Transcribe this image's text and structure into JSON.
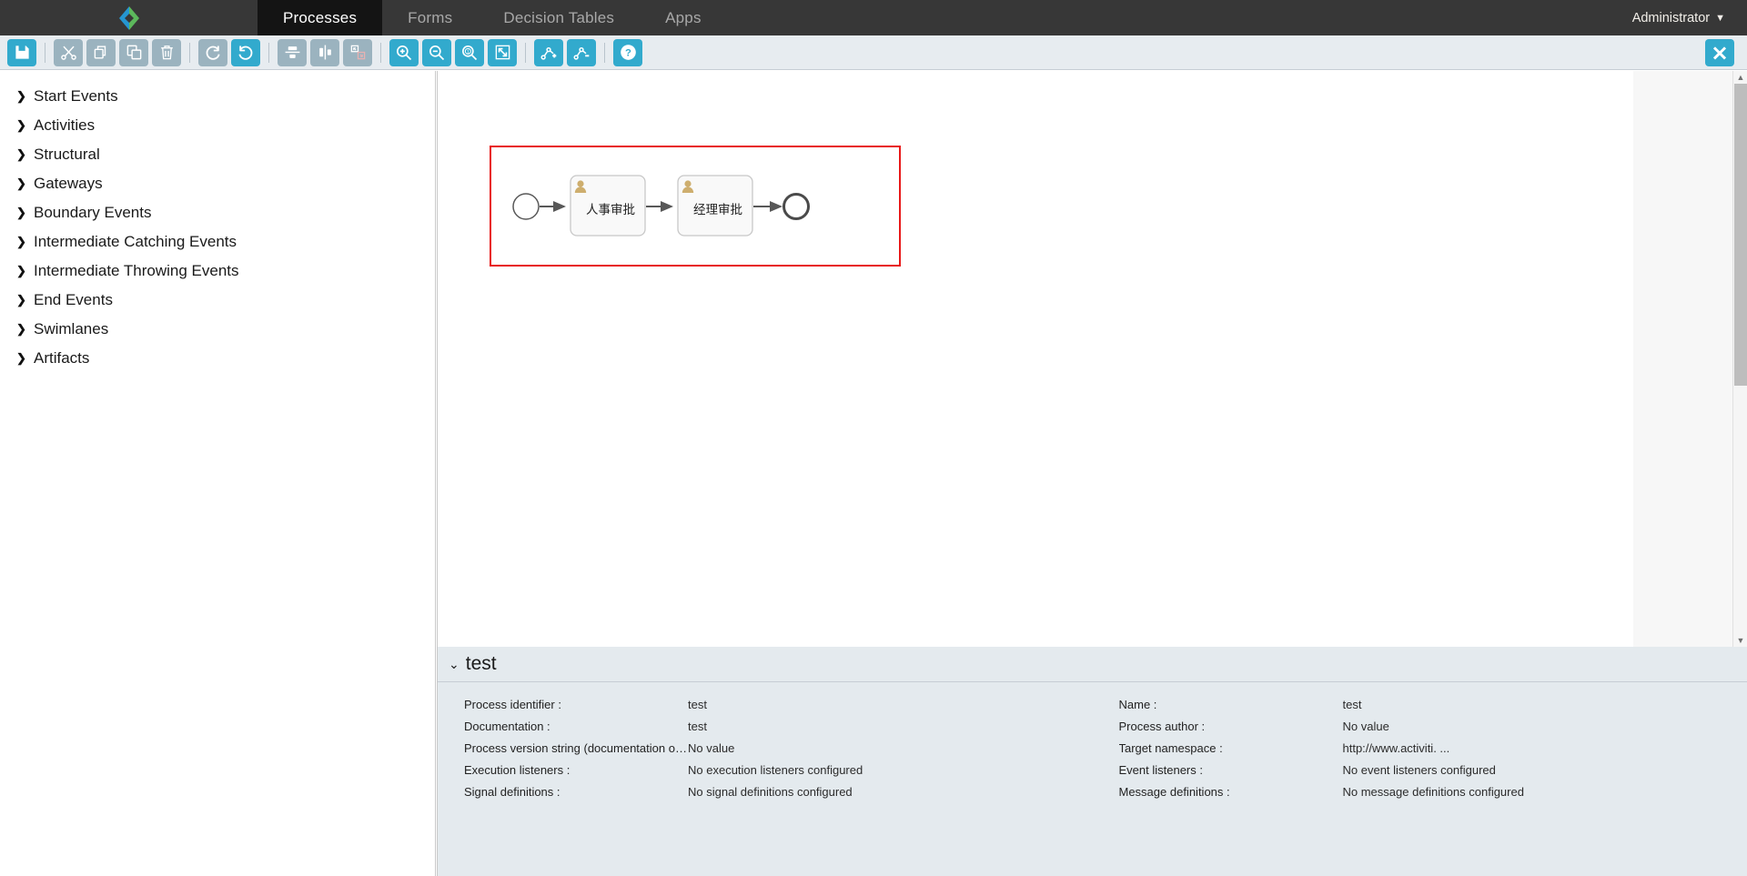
{
  "topnav": {
    "logo_icon": "activiti-diamond-logo",
    "tabs": [
      {
        "label": "Processes",
        "active": true
      },
      {
        "label": "Forms",
        "active": false
      },
      {
        "label": "Decision Tables",
        "active": false
      },
      {
        "label": "Apps",
        "active": false
      }
    ],
    "user": "Administrator",
    "user_caret": "⌄"
  },
  "toolbar": {
    "buttons": [
      {
        "name": "save-button",
        "icon": "floppy-disk-icon",
        "style": "cyan"
      },
      {
        "name": "separator",
        "icon": "separator",
        "style": "sep"
      },
      {
        "name": "cut-button",
        "icon": "scissors-icon",
        "style": "grey"
      },
      {
        "name": "copy-button",
        "icon": "copy-icon",
        "style": "grey"
      },
      {
        "name": "paste-button",
        "icon": "paste-icon",
        "style": "grey"
      },
      {
        "name": "delete-button",
        "icon": "trash-icon",
        "style": "grey"
      },
      {
        "name": "separator",
        "icon": "separator",
        "style": "sep"
      },
      {
        "name": "redo-button",
        "icon": "redo-arrow-icon",
        "style": "grey"
      },
      {
        "name": "undo-button",
        "icon": "undo-arrow-icon",
        "style": "cyan"
      },
      {
        "name": "separator",
        "icon": "separator",
        "style": "sep"
      },
      {
        "name": "align-vertical-button",
        "icon": "align-vertical-icon",
        "style": "grey"
      },
      {
        "name": "align-horizontal-button",
        "icon": "align-horizontal-icon",
        "style": "grey"
      },
      {
        "name": "same-size-button",
        "icon": "same-size-icon",
        "style": "grey"
      },
      {
        "name": "separator",
        "icon": "separator",
        "style": "sep"
      },
      {
        "name": "zoom-in-button",
        "icon": "zoom-in-icon",
        "style": "cyan"
      },
      {
        "name": "zoom-out-button",
        "icon": "zoom-out-icon",
        "style": "cyan"
      },
      {
        "name": "zoom-actual-button",
        "icon": "zoom-actual-size-icon",
        "style": "cyan"
      },
      {
        "name": "zoom-fit-button",
        "icon": "zoom-fit-icon",
        "style": "cyan"
      },
      {
        "name": "separator",
        "icon": "separator",
        "style": "sep"
      },
      {
        "name": "add-bendpoint-button",
        "icon": "add-bendpoint-icon",
        "style": "cyan"
      },
      {
        "name": "remove-bendpoint-button",
        "icon": "remove-bendpoint-icon",
        "style": "cyan"
      },
      {
        "name": "separator",
        "icon": "separator",
        "style": "sep"
      },
      {
        "name": "help-button",
        "icon": "question-mark-icon",
        "style": "cyan"
      }
    ],
    "close_button": {
      "name": "close-editor-button",
      "icon": "close-x-icon",
      "style": "cyan"
    }
  },
  "palette": {
    "items": [
      {
        "label": "Start Events"
      },
      {
        "label": "Activities"
      },
      {
        "label": "Structural"
      },
      {
        "label": "Gateways"
      },
      {
        "label": "Boundary Events"
      },
      {
        "label": "Intermediate Catching Events"
      },
      {
        "label": "Intermediate Throwing Events"
      },
      {
        "label": "End Events"
      },
      {
        "label": "Swimlanes"
      },
      {
        "label": "Artifacts"
      }
    ],
    "expand_arrow": "❯"
  },
  "diagram": {
    "selection_color": "#e81919",
    "nodes": [
      {
        "type": "start-event",
        "name": "start-event",
        "label": ""
      },
      {
        "type": "user-task",
        "name": "user-task-hr",
        "label": "人事审批"
      },
      {
        "type": "user-task",
        "name": "user-task-manager",
        "label": "经理审批"
      },
      {
        "type": "end-event",
        "name": "end-event",
        "label": ""
      }
    ]
  },
  "properties": {
    "title": "test",
    "collapse_caret": "⌄",
    "left": [
      {
        "label": "Process identifier :",
        "value": "test"
      },
      {
        "label": "Documentation :",
        "value": "test"
      },
      {
        "label": "Process version string (documentation only) :",
        "value": "No value"
      },
      {
        "label": "Execution listeners :",
        "value": "No execution listeners configured"
      },
      {
        "label": "Signal definitions :",
        "value": "No signal definitions configured"
      }
    ],
    "right": [
      {
        "label": "Name :",
        "value": "test"
      },
      {
        "label": "Process author :",
        "value": "No value"
      },
      {
        "label": "Target namespace :",
        "value": "http://www.activiti. ..."
      },
      {
        "label": "Event listeners :",
        "value": "No event listeners configured"
      },
      {
        "label": "Message definitions :",
        "value": "No message definitions configured"
      }
    ]
  },
  "scrollbar": {
    "up_arrow": "▲",
    "down_arrow": "▼"
  }
}
